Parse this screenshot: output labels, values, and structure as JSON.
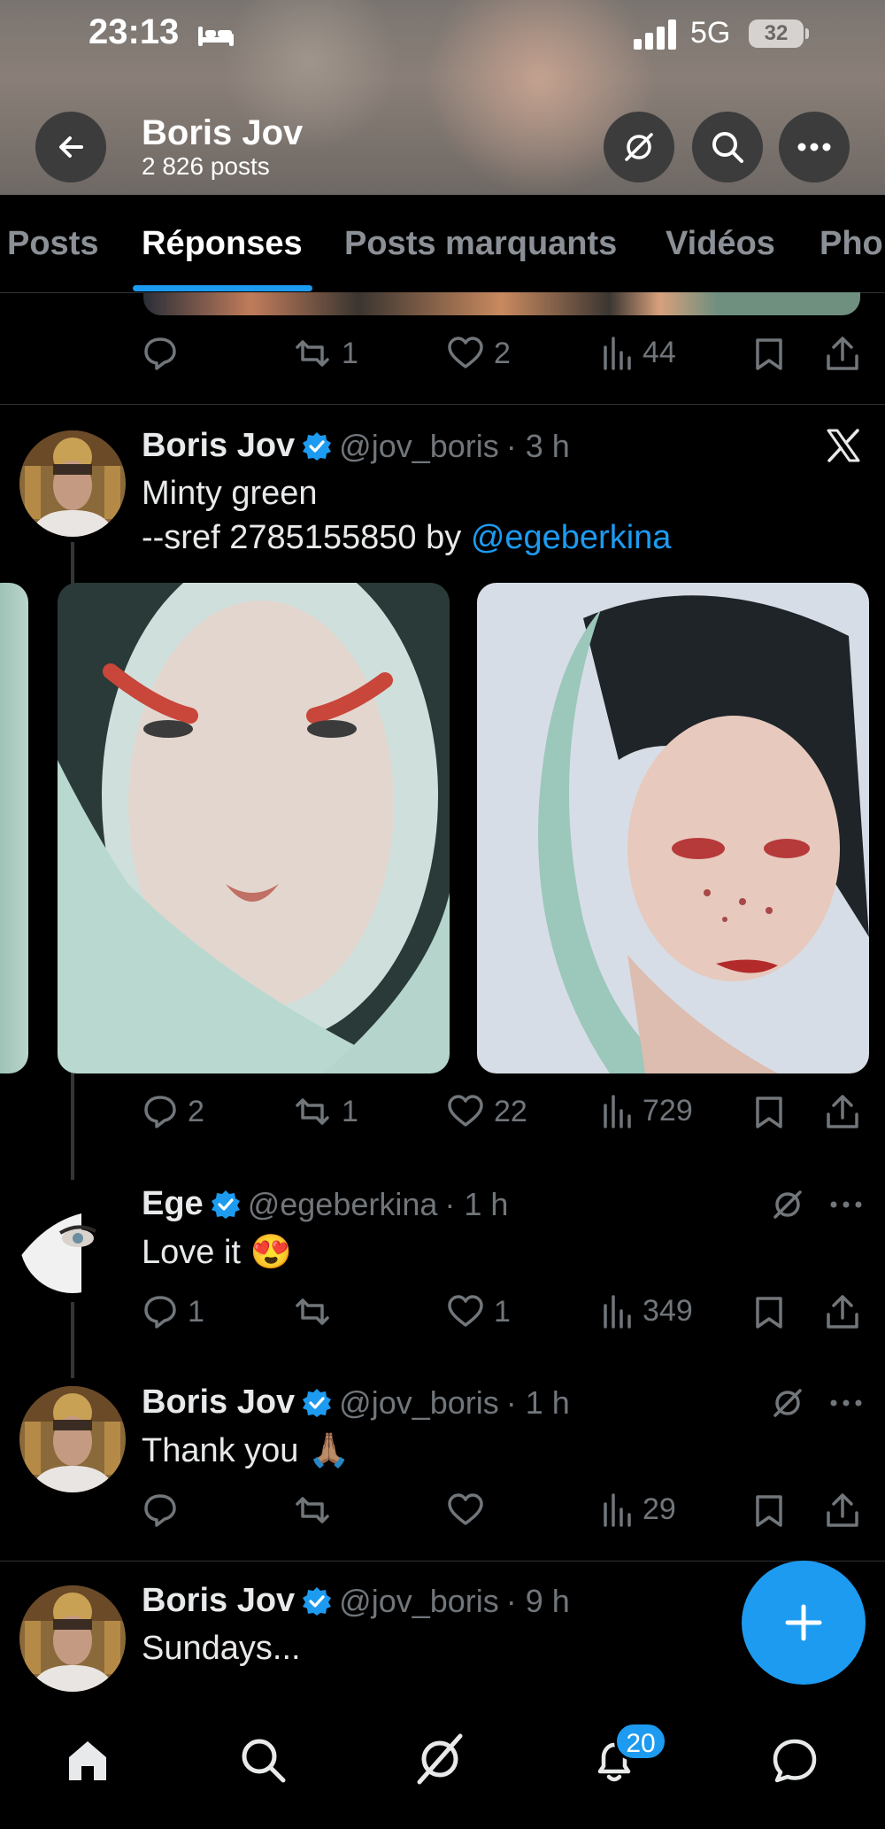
{
  "status_bar": {
    "time": "23:13",
    "network": "5G",
    "battery": "32"
  },
  "profile": {
    "name": "Boris Jov",
    "posts_count": "2 826 posts"
  },
  "tabs": [
    {
      "label": "Posts",
      "active": false
    },
    {
      "label": "Réponses",
      "active": true
    },
    {
      "label": "Posts marquants",
      "active": false
    },
    {
      "label": "Vidéos",
      "active": false
    },
    {
      "label": "Pho",
      "active": false
    }
  ],
  "prev_post_actions": {
    "replies": "",
    "reposts": "1",
    "likes": "2",
    "views": "44"
  },
  "main_post": {
    "author": "Boris Jov",
    "handle": "@jov_boris",
    "time": "· 3 h",
    "text_line1": "Minty green",
    "text_line2_prefix": "--sref 2785155850 by ",
    "mention": "@egeberkina",
    "actions": {
      "replies": "2",
      "reposts": "1",
      "likes": "22",
      "views": "729"
    }
  },
  "reply_1": {
    "author": "Ege",
    "handle": "@egeberkina",
    "time": "· 1 h",
    "text": "Love it 😍",
    "actions": {
      "replies": "1",
      "reposts": "",
      "likes": "1",
      "views": "349"
    }
  },
  "reply_2": {
    "author": "Boris Jov",
    "handle": "@jov_boris",
    "time": "· 1 h",
    "text": "Thank you 🙏🏽",
    "actions": {
      "replies": "",
      "reposts": "",
      "likes": "",
      "views": "29"
    }
  },
  "next_post": {
    "author": "Boris Jov",
    "handle": "@jov_boris",
    "time": "· 9 h",
    "text": "Sundays..."
  },
  "notifications_badge": "20",
  "colors": {
    "accent": "#1d9bf0",
    "background": "#000000",
    "muted": "#71767b"
  }
}
